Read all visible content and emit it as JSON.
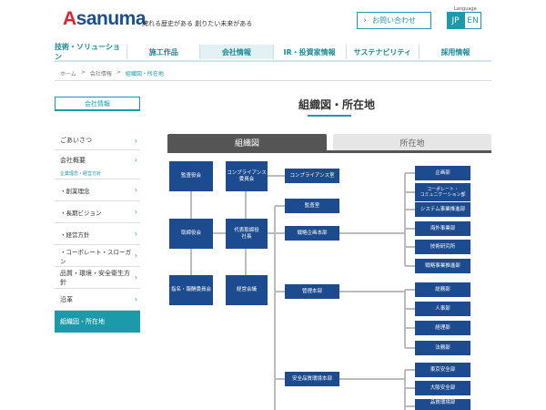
{
  "header": {
    "logo_initial": "A",
    "logo_rest": "sanuma",
    "tagline": "誇れる歴史がある 創りたい未来がある",
    "contact_chevron": "›",
    "contact_label": "お問い合わせ",
    "language_caption": "Language",
    "languages": [
      "JP",
      "EN"
    ]
  },
  "nav": [
    "技術・ソリューション",
    "施工作品",
    "会社情報",
    "IR・投資家情報",
    "サステナビリティ",
    "採用情報"
  ],
  "breadcrumb": [
    "ホーム",
    ">",
    "会社情報",
    ">",
    "組織図・所在地"
  ],
  "sidebar": {
    "heading": "会社情報",
    "chevron": "›",
    "items": [
      "ごあいさつ",
      "会社概要",
      "企業理念・経営方針",
      "・創業理念",
      "・長期ビジョン",
      "・経営方針",
      "・コーポレート・スローガン",
      "品質・環境・安全衛生方針",
      "沿革",
      "組織図・所在地"
    ]
  },
  "main": {
    "title": "組織図・所在地",
    "tabs": [
      "組織図",
      "所在地"
    ]
  },
  "org": {
    "left": [
      "監査役会",
      "取締役会",
      "指名・報酬委員会"
    ],
    "center": [
      "コンプライアンス\n委員会",
      "代表取締役\n社長",
      "経営会議"
    ],
    "mid": [
      "コンプライアンス室",
      "監査室",
      "戦略企画本部",
      "管理本部",
      "安全品質環境本部"
    ],
    "right": [
      "企画部",
      "コーポレート・\nコミュニケーション部",
      "システム事業推進部",
      "海外事業部",
      "技術研究所",
      "戦略事業推進部",
      "総務部",
      "人事部",
      "経理部",
      "法務部",
      "東京安全部",
      "大阪安全部",
      "品質環境部"
    ]
  },
  "colors": {
    "accent": "#1b9aaa",
    "box": "#1d4b8f",
    "brand": "#1a5091",
    "logo_mark": "#d9262e"
  }
}
